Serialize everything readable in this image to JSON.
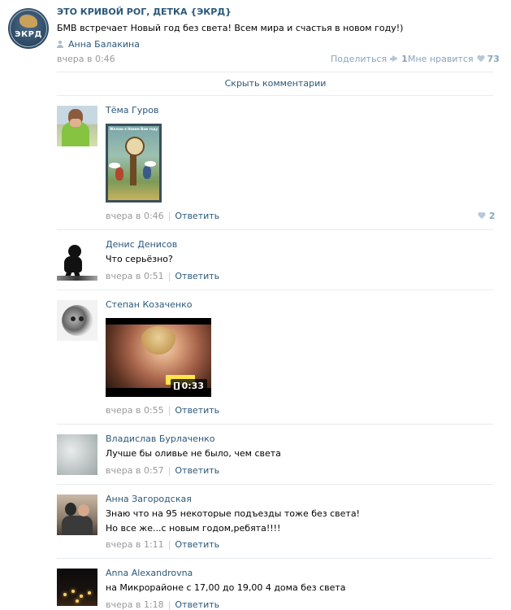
{
  "post": {
    "group_name": "ЭТО КРИВОЙ РОГ, ДЕТКА {ЭКРД}",
    "avatar_text": "ЭКРД",
    "text": "БМВ встречает Новый год без света! Всем мира и счастья в новом году!)",
    "author": "Анна Балакина",
    "date": "вчера в 0:46",
    "share_label": "Поделиться",
    "share_count": "1",
    "like_label": "Мне нравится",
    "like_count": "73",
    "hide_comments_label": "Скрыть комментарии"
  },
  "reply_label": "Ответить",
  "comments": [
    {
      "author": "Тёма Гуров",
      "text": "",
      "date": "вчера в 0:46",
      "likes": "2",
      "attachment": {
        "type": "photo",
        "caption": "Желаю в Новом Вам году"
      }
    },
    {
      "author": "Денис Денисов",
      "text": "Что серьёзно?",
      "date": "вчера в 0:51"
    },
    {
      "author": "Степан Козаченко",
      "text": "",
      "date": "вчера в 0:55",
      "attachment": {
        "type": "video",
        "duration": "0:33"
      }
    },
    {
      "author": "Владислав Бурлаченко",
      "text": "Лучше бы оливье не было, чем света",
      "date": "вчера в 0:57"
    },
    {
      "author": "Анна Загородская",
      "text_lines": [
        "Знаю что на 95 некоторые подъезды тоже без света!",
        "Но все же...с новым годом,ребята!!!!"
      ],
      "date": "вчера в 1:11"
    },
    {
      "author": "Anna Alexandrovna",
      "text": "на Микрорайоне с 17,00 до 19,00 4 дома без света",
      "date": "вчера в 1:18"
    }
  ],
  "icons": {
    "user": "user-icon",
    "share": "megaphone-icon",
    "like": "heart-icon",
    "video": "film-icon"
  },
  "colors": {
    "link": "#2b587a",
    "meta": "#999999",
    "counter": "#8aa4bc",
    "separator": "#e7ebf0"
  }
}
